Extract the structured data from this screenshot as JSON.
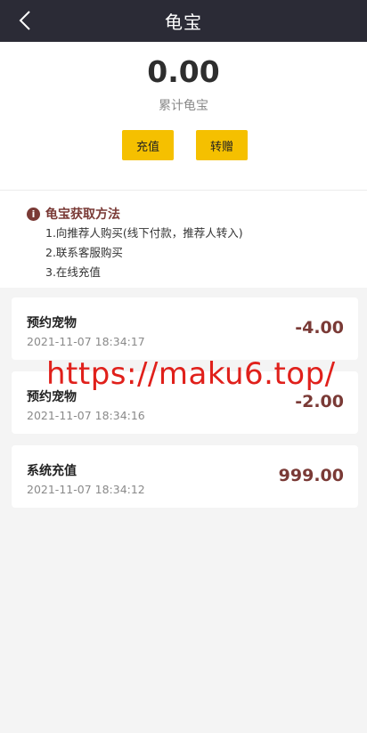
{
  "header": {
    "title": "龟宝",
    "back_icon": "chevron-left-icon"
  },
  "balance": {
    "value": "0.00",
    "label": "累计龟宝"
  },
  "actions": {
    "recharge_label": "充值",
    "transfer_label": "转赠"
  },
  "info": {
    "title": "龟宝获取方法",
    "icon_glyph": "i",
    "lines": [
      "1.向推荐人购买(线下付款，推荐人转入)",
      "2.联系客服购买",
      "3.在线充值"
    ]
  },
  "records": [
    {
      "title": "预约宠物",
      "time": "2021-11-07 18:34:17",
      "amount": "-4.00"
    },
    {
      "title": "预约宠物",
      "time": "2021-11-07 18:34:16",
      "amount": "-2.00"
    },
    {
      "title": "系统充值",
      "time": "2021-11-07 18:34:12",
      "amount": "999.00"
    }
  ],
  "watermark": "https://maku6.top/",
  "colors": {
    "header_bg": "#2b2b36",
    "accent_button": "#f5c000",
    "amount_text": "#7a3a36",
    "watermark": "#e0201b"
  }
}
